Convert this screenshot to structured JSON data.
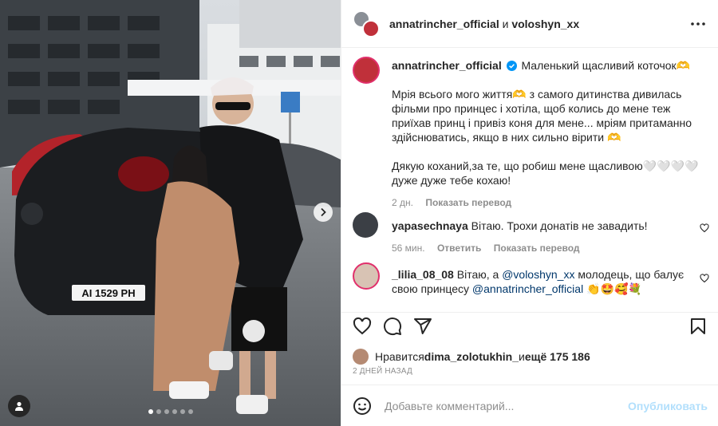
{
  "header": {
    "user1": "annatrincher_official",
    "joiner": " и ",
    "user2": "voloshyn_xx",
    "more_icon": "more-horizontal-icon"
  },
  "photo": {
    "license_plate": "AI 1529 PH",
    "carousel_dots": 6,
    "active_dot": 0,
    "next_icon": "chevron-right-icon",
    "tag_icon": "user-tag-icon"
  },
  "caption": {
    "username": "annatrincher_official",
    "verified": true,
    "title": "Маленький щасливий коточок🫶",
    "p1": "Мрія всього мого життя🫶 з самого дитинства дивилась фільми про принцес і хотіла, щоб колись до мене теж приїхав принц і привіз коня для мене... мріям притаманно здійснюватись, якщо в них сильно вірити 🫶",
    "p2": "Дякую коханий,за те, що робиш мене щасливою🤍🤍🤍🤍 дуже дуже тебе кохаю!",
    "time": "2 дн.",
    "translate": "Показать перевод"
  },
  "comments": [
    {
      "username": "yapasechnaya",
      "text": "Вітаю. Трохи донатів не завадить!",
      "time": "56 мин.",
      "reply": "Ответить",
      "translate": "Показать перевод"
    },
    {
      "username": "_lilia_08_08",
      "text_before": "Вітаю, а ",
      "mention1": "@voloshyn_xx",
      "text_middle": " молодець, що балує свою принцесу ",
      "mention2": "@annatrincher_official",
      "text_after": " 👏🤩🥰💐"
    }
  ],
  "actions": {
    "like_icon": "heart-icon",
    "comment_icon": "comment-icon",
    "share_icon": "share-icon",
    "save_icon": "bookmark-icon"
  },
  "likes": {
    "prefix": "Нравится ",
    "user": "dima_zolotukhin_",
    "middle": " и ",
    "count": "ещё 175 186"
  },
  "date": "2 ДНЕЙ НАЗАД",
  "add_comment": {
    "placeholder": "Добавьте комментарий...",
    "publish": "Опубликовать",
    "emoji_icon": "emoji-icon"
  },
  "colors": {
    "text": "#262626",
    "muted": "#8e8e8e",
    "link": "#00376b",
    "publish_disabled": "#b2dffc",
    "verified": "#0095f6"
  }
}
